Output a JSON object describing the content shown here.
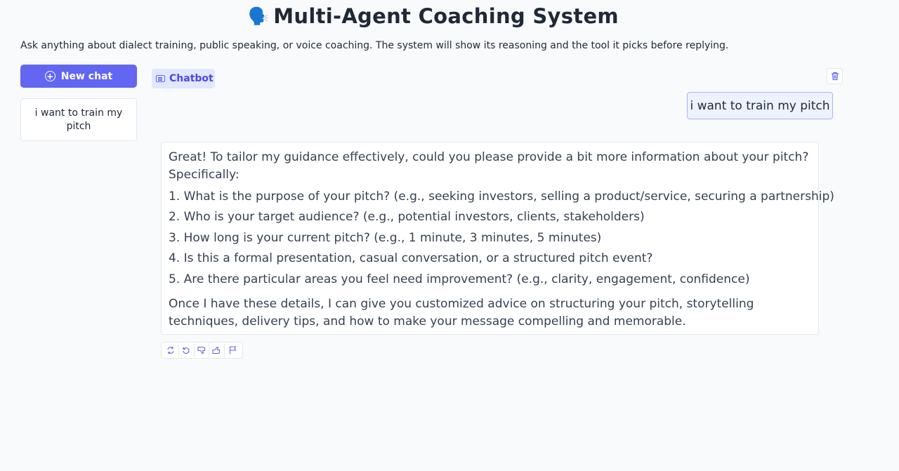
{
  "header": {
    "title_emoji": "🗣️",
    "title": "Multi-Agent Coaching System",
    "subtitle": "Ask anything about dialect training, public speaking, or voice coaching. The system will show its reasoning and the tool it picks before replying."
  },
  "sidebar": {
    "new_chat_label": "New chat",
    "new_chat_icon": "plus-circle-icon",
    "history": [
      {
        "label": "i want to train my pitch"
      }
    ]
  },
  "chat": {
    "label": "Chatbot",
    "label_icon": "chat-bubble-icon",
    "clear_icon": "trash-icon",
    "messages": [
      {
        "role": "user",
        "text": "i want to train my pitch"
      },
      {
        "role": "assistant",
        "intro": "Great! To tailor my guidance effectively, could you please provide a bit more information about your pitch? Specifically:",
        "items": [
          "1. What is the purpose of your pitch? (e.g., seeking investors, selling a product/service, securing a partnership)",
          "2. Who is your target audience? (e.g., potential investors, clients, stakeholders)",
          "3. How long is your current pitch? (e.g., 1 minute, 3 minutes, 5 minutes)",
          "4. Is this a formal presentation, casual conversation, or a structured pitch event?",
          "5. Are there particular areas you feel need improvement? (e.g., clarity, engagement, confidence)"
        ],
        "outro": "Once I have these details, I can give you customized advice on structuring your pitch, storytelling techniques, delivery tips, and how to make your message compelling and memorable."
      }
    ],
    "actions": [
      "retry-icon",
      "undo-icon",
      "thumbs-down-icon",
      "thumbs-up-icon",
      "flag-icon"
    ]
  },
  "colors": {
    "accent": "#6366f1",
    "background": "#f8fafc",
    "user_bubble": "#eef2ff",
    "user_border": "#a5b4fc"
  }
}
